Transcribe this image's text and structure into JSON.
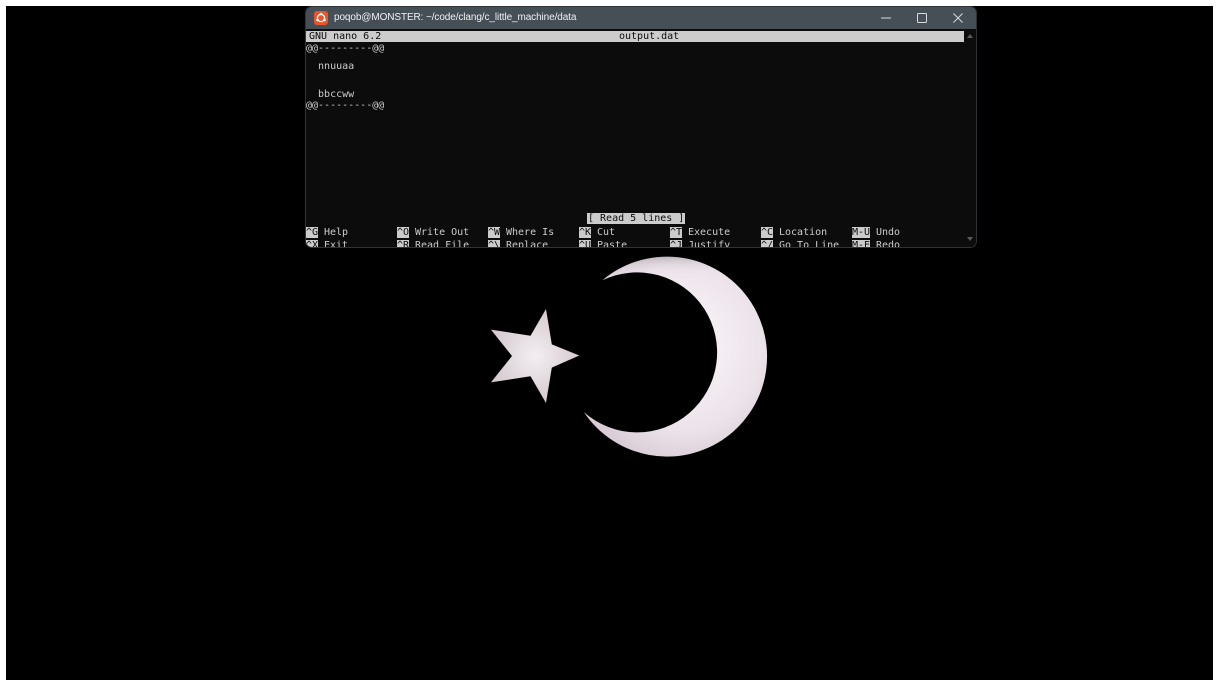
{
  "window": {
    "title": "poqob@MONSTER: ~/code/clang/c_little_machine/data",
    "app_icon": "ubuntu-icon",
    "controls": [
      "minimize-icon",
      "maximize-icon",
      "close-icon"
    ]
  },
  "nano": {
    "version": "GNU nano 6.2",
    "filename": "output.dat",
    "lines": [
      "@@---------@@",
      "  nnuuaa",
      "",
      "  bbccww",
      "@@---------@@"
    ],
    "status": "[ Read 5 lines ]",
    "shortcuts": [
      [
        {
          "key": "^G",
          "label": "Help"
        },
        {
          "key": "^O",
          "label": "Write Out"
        },
        {
          "key": "^W",
          "label": "Where Is"
        },
        {
          "key": "^K",
          "label": "Cut"
        },
        {
          "key": "^T",
          "label": "Execute"
        },
        {
          "key": "^C",
          "label": "Location"
        },
        {
          "key": "M-U",
          "label": "Undo"
        }
      ],
      [
        {
          "key": "^X",
          "label": "Exit"
        },
        {
          "key": "^R",
          "label": "Read File"
        },
        {
          "key": "^\\",
          "label": "Replace"
        },
        {
          "key": "^U",
          "label": "Paste"
        },
        {
          "key": "^J",
          "label": "Justify"
        },
        {
          "key": "^/",
          "label": "Go To Line"
        },
        {
          "key": "M-E",
          "label": "Redo"
        }
      ]
    ]
  },
  "wallpaper": {
    "background": "#000000",
    "emblem": "star-and-crescent",
    "emblem_color": "#ece6ea"
  }
}
